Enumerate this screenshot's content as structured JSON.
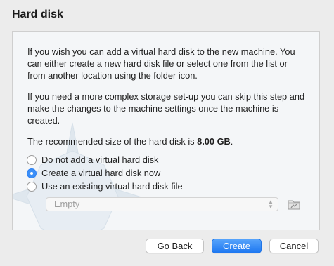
{
  "dialog": {
    "title": "Hard disk"
  },
  "content": {
    "paragraph1": "If you wish you can add a virtual hard disk to the new machine. You can either create a new hard disk file or select one from the list or from another location using the folder icon.",
    "paragraph2": "If you need a more complex storage set-up you can skip this step and make the changes to the machine settings once the machine is created.",
    "recommended_prefix": "The recommended size of the hard disk is ",
    "recommended_size": "8.00 GB",
    "recommended_suffix": "."
  },
  "options": [
    {
      "label": "Do not add a virtual hard disk",
      "selected": false
    },
    {
      "label": "Create a virtual hard disk now",
      "selected": true
    },
    {
      "label": "Use an existing virtual hard disk file",
      "selected": false
    }
  ],
  "disk_selector": {
    "value": "Empty",
    "enabled": false
  },
  "buttons": {
    "back": "Go Back",
    "create": "Create",
    "cancel": "Cancel"
  },
  "icons": {
    "folder": "folder-icon",
    "select_arrows": "up-down-chevron-icon"
  },
  "colors": {
    "accent": "#1e78f1",
    "window_bg": "#ececec",
    "panel_bg": "#f4f6f8"
  }
}
